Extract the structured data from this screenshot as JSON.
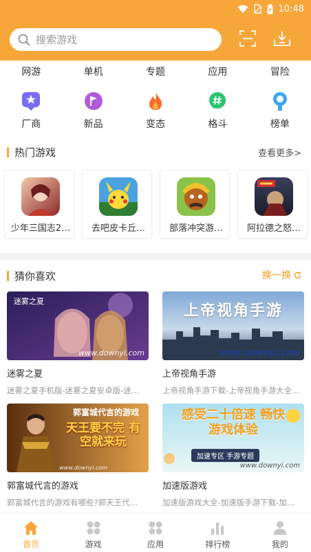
{
  "status_bar": {
    "time": "10:48"
  },
  "search": {
    "placeholder": "搜索游戏"
  },
  "nav": [
    "网游",
    "单机",
    "专题",
    "应用",
    "冒险"
  ],
  "categories": [
    {
      "label": "厂商",
      "icon": "star-badge-icon",
      "color": "#7b6cf6"
    },
    {
      "label": "新品",
      "icon": "flag-icon",
      "color": "#b05bd8"
    },
    {
      "label": "变态",
      "icon": "flame-icon",
      "color": "#f86a2b"
    },
    {
      "label": "格斗",
      "icon": "hashtag-icon",
      "color": "#2cc56f"
    },
    {
      "label": "榜单",
      "icon": "medal-icon",
      "color": "#3aa8f0"
    }
  ],
  "hot": {
    "title": "热门游戏",
    "more": "查看更多>",
    "games": [
      {
        "name": "少年三国志2…"
      },
      {
        "name": "去吧皮卡丘…"
      },
      {
        "name": "部落冲突游…"
      },
      {
        "name": "阿拉德之怒…"
      }
    ]
  },
  "guess": {
    "title": "猜你喜欢",
    "refresh": "换一换",
    "items": [
      {
        "title": "迷雾之夏",
        "desc": "迷雾之夏手机版-迷雾之夏安卓版-迷…",
        "image_text": "迷雾之夏",
        "watermark": "www.downyi.com"
      },
      {
        "title": "上帝视角手游",
        "desc": "上帝视角手游下载-上帝视角手游大全…",
        "image_text": "上帝视角手游",
        "watermark": "www.downyi.com"
      },
      {
        "title": "郭富城代言的游戏",
        "desc": "郭富城代言的游戏有哪些?郭天王代…",
        "image_text": "郭富城代言的游戏",
        "image_text2": "天王要不完 有空就来玩",
        "watermark": "www.downyi.com"
      },
      {
        "title": "加速版游戏",
        "desc": "加速版游戏大全-加速版手游下载-加…",
        "image_text": "感受二十倍速 畅快游戏体验",
        "image_text2": "加速专区 手游专题",
        "watermark": "www.downyi.com"
      }
    ]
  },
  "tabs": [
    {
      "label": "首页",
      "icon": "home-icon",
      "active": true
    },
    {
      "label": "游戏",
      "icon": "games-icon"
    },
    {
      "label": "应用",
      "icon": "apps-icon"
    },
    {
      "label": "排行榜",
      "icon": "ranking-icon"
    },
    {
      "label": "我的",
      "icon": "profile-icon"
    }
  ],
  "colors": {
    "accent": "#f7a63a",
    "refresh": "#f39c1e"
  }
}
